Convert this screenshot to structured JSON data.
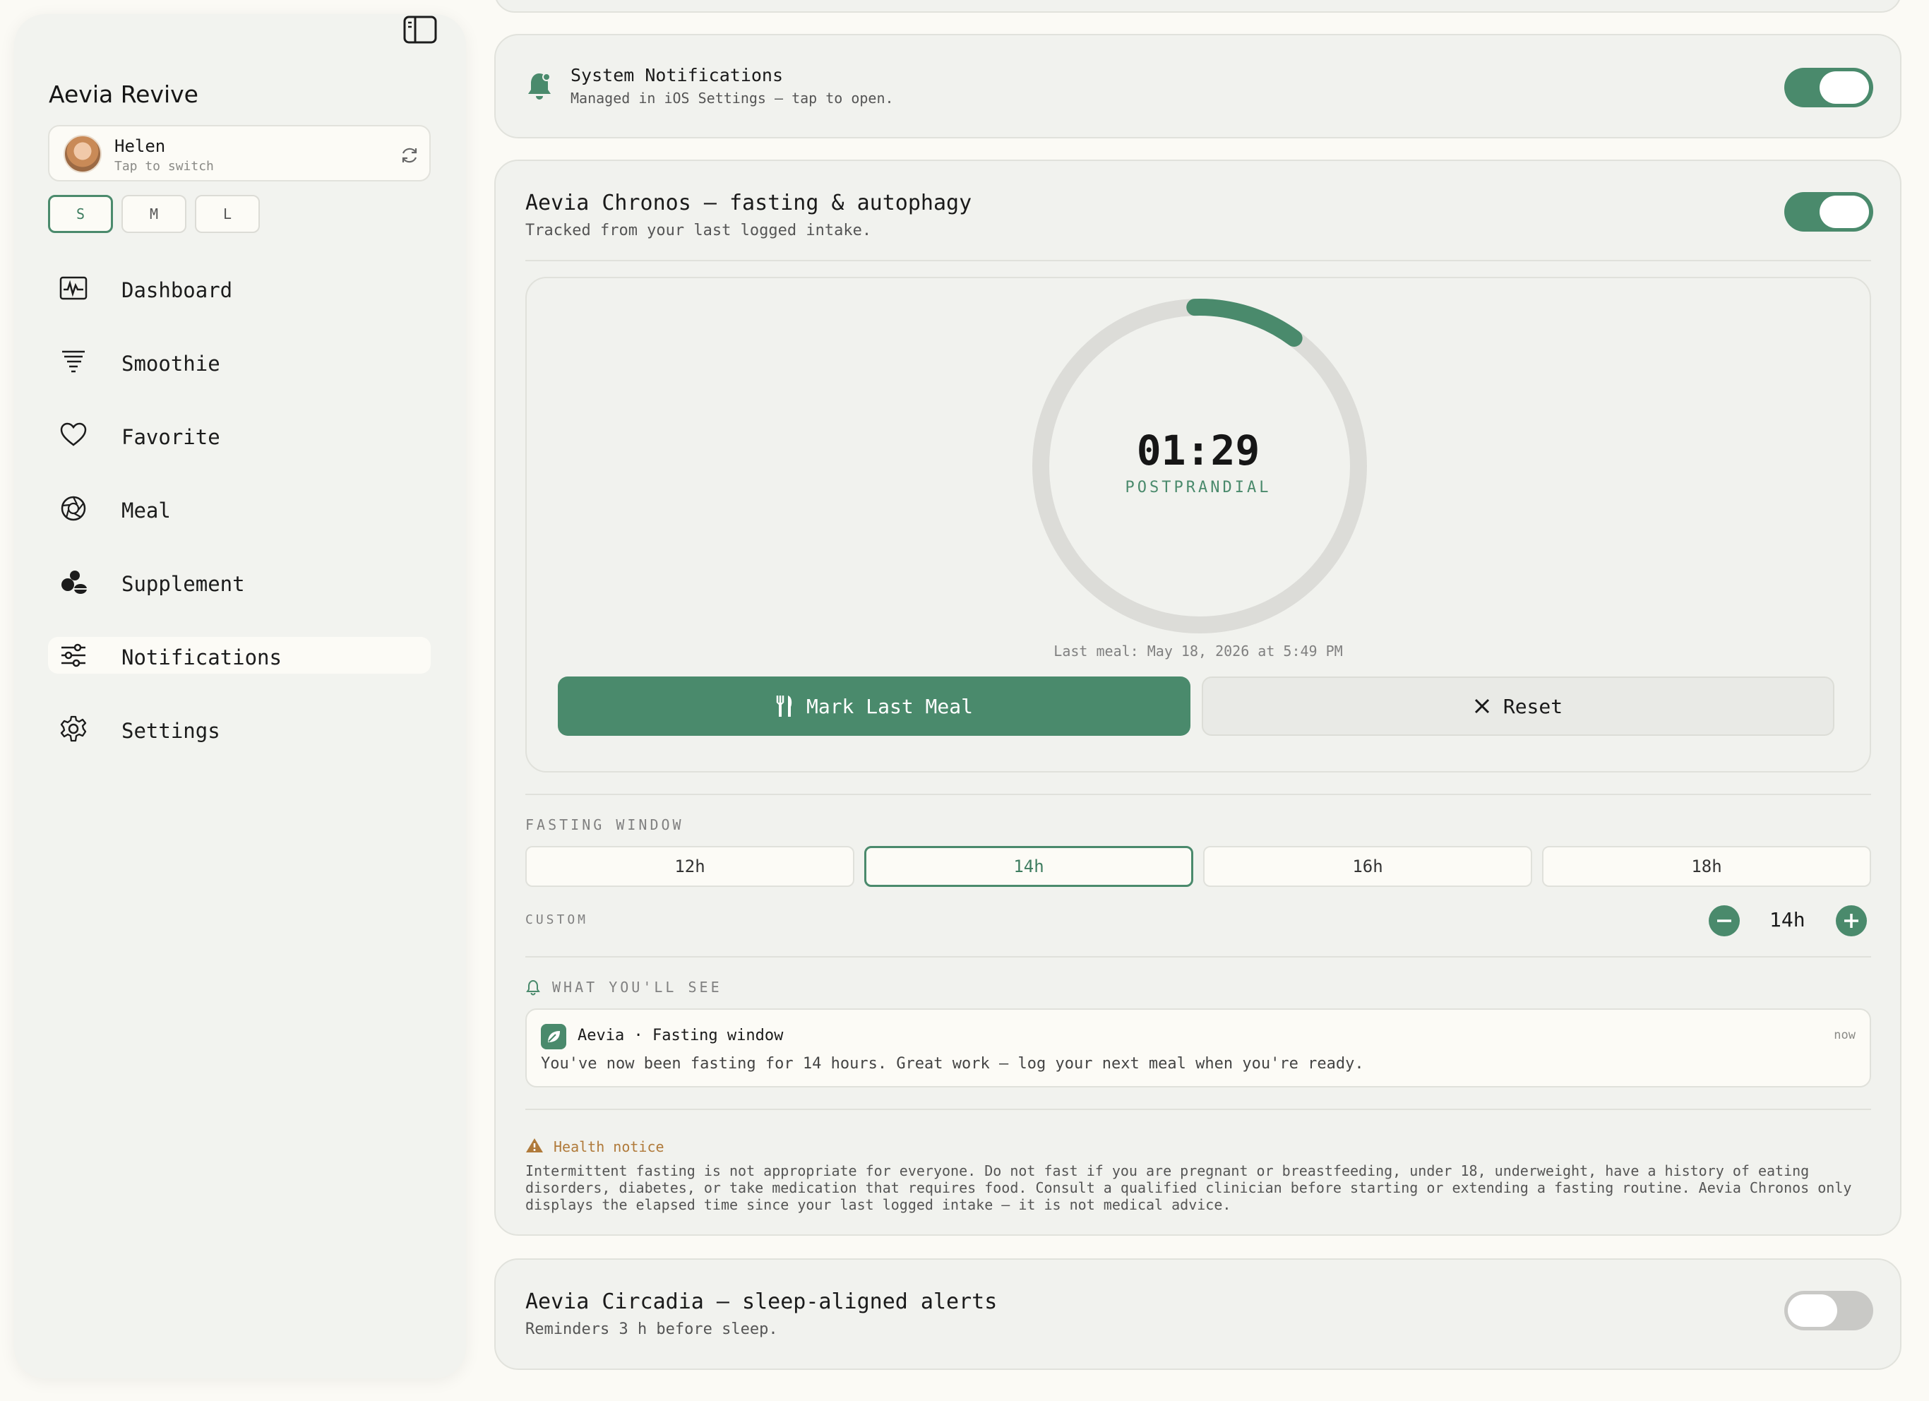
{
  "app": {
    "title": "Aevia Revive"
  },
  "profile": {
    "name": "Helen",
    "subtitle": "Tap to switch"
  },
  "text_sizes": [
    {
      "label": "S",
      "selected": true
    },
    {
      "label": "M",
      "selected": false
    },
    {
      "label": "L",
      "selected": false
    }
  ],
  "nav": [
    {
      "label": "Dashboard",
      "icon": "pulse-chart-icon",
      "active": false
    },
    {
      "label": "Smoothie",
      "icon": "tornado-icon",
      "active": false
    },
    {
      "label": "Favorite",
      "icon": "heart-icon",
      "active": false
    },
    {
      "label": "Meal",
      "icon": "aperture-icon",
      "active": false
    },
    {
      "label": "Supplement",
      "icon": "pills-icon",
      "active": false
    },
    {
      "label": "Notifications",
      "icon": "sliders-icon",
      "active": true
    },
    {
      "label": "Settings",
      "icon": "gear-icon",
      "active": false
    }
  ],
  "system_notifications": {
    "title": "System Notifications",
    "subtitle": "Managed in iOS Settings — tap to open.",
    "enabled": true
  },
  "chronos": {
    "title": "Aevia Chronos — fasting & autophagy",
    "subtitle": "Tracked from your last logged intake.",
    "enabled": true,
    "timer": {
      "elapsed": "01:29",
      "phase": "POSTPRANDIAL",
      "progress": 0.106,
      "last_meal": "Last meal: May 18, 2026 at 5:49 PM"
    },
    "mark_button": "Mark Last Meal",
    "reset_button": "Reset",
    "window_label": "FASTING WINDOW",
    "windows": [
      {
        "label": "12h",
        "selected": false
      },
      {
        "label": "14h",
        "selected": true
      },
      {
        "label": "16h",
        "selected": false
      },
      {
        "label": "18h",
        "selected": false
      }
    ],
    "custom_label": "CUSTOM",
    "custom_value": "14h",
    "preview_label": "WHAT YOU'LL SEE",
    "preview": {
      "app": "Aevia · Fasting window",
      "time": "now",
      "body": "You've now been fasting for 14 hours. Great work — log your next meal when you're ready."
    },
    "notice_title": "Health notice",
    "notice_body": "Intermittent fasting is not appropriate for everyone. Do not fast if you are pregnant or breastfeeding, under 18, underweight, have a history of eating disorders, diabetes, or take medication that requires food. Consult a qualified clinician before starting or extending a fasting routine. Aevia Chronos only displays the elapsed time since your last logged intake — it is not medical advice."
  },
  "circadia": {
    "title": "Aevia Circadia — sleep-aligned alerts",
    "subtitle": "Reminders 3 h before sleep.",
    "enabled": false
  },
  "colors": {
    "accent": "#4a8a6c",
    "warning": "#b07a3a",
    "track": "#dcdcd8"
  }
}
